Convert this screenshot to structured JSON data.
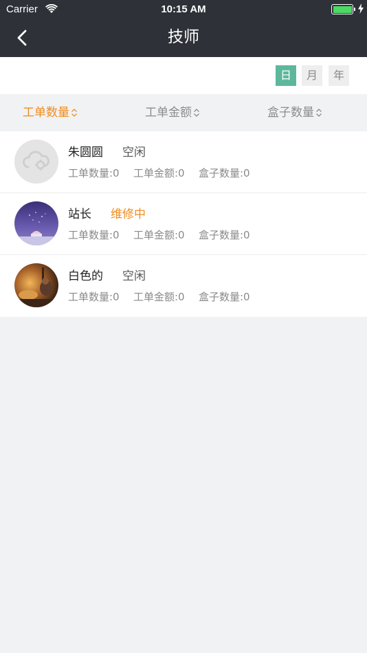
{
  "status_bar": {
    "carrier": "Carrier",
    "time": "10:15 AM",
    "battery_level": 1.0
  },
  "nav": {
    "title": "技师",
    "back_icon": "chevron-left-icon"
  },
  "period": {
    "options": [
      {
        "label": "日",
        "active": true
      },
      {
        "label": "月",
        "active": false
      },
      {
        "label": "年",
        "active": false
      }
    ]
  },
  "sort": {
    "options": [
      {
        "label": "工单数量",
        "active": true,
        "icon": "sort-updown-icon"
      },
      {
        "label": "工单金额",
        "active": false,
        "icon": "sort-updown-icon"
      },
      {
        "label": "盒子数量",
        "active": false,
        "icon": "sort-updown-icon"
      }
    ]
  },
  "technicians": [
    {
      "name": "朱圆圆",
      "status": "空闲",
      "status_busy": false,
      "avatar": "placeholder-avatar",
      "orders": "工单数量:0",
      "amount": "工单金额:0",
      "boxes": "盒子数量:0"
    },
    {
      "name": "站长",
      "status": "维修中",
      "status_busy": true,
      "avatar": "night-sky-avatar",
      "orders": "工单数量:0",
      "amount": "工单金额:0",
      "boxes": "盒子数量:0"
    },
    {
      "name": "白色的",
      "status": "空闲",
      "status_busy": false,
      "avatar": "warm-photo-avatar",
      "orders": "工单数量:0",
      "amount": "工单金额:0",
      "boxes": "盒子数量:0"
    }
  ],
  "colors": {
    "nav_bg": "#2e3138",
    "accent_orange": "#f08c1e",
    "accent_green": "#5cb89c"
  }
}
